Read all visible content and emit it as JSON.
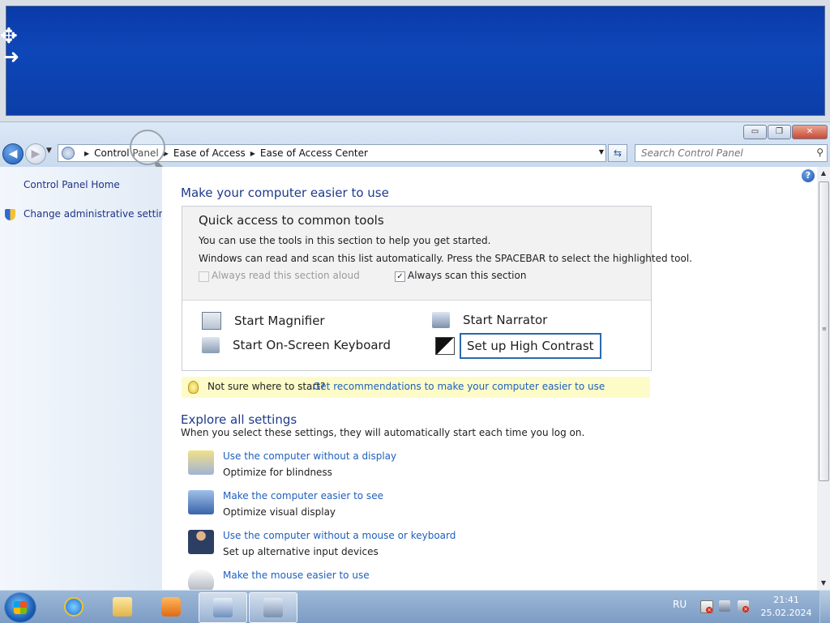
{
  "window": {
    "controls": {
      "minimize": "▭",
      "maximize": "❐",
      "close": "✕"
    }
  },
  "nav": {
    "back": "◀",
    "forward": "▶",
    "breadcrumbs": [
      "Control Panel",
      "Ease of Access",
      "Ease of Access Center"
    ],
    "search_placeholder": "Search Control Panel"
  },
  "sidebar": {
    "items": [
      {
        "label": "Control Panel Home",
        "icon": null
      },
      {
        "label": "Change administrative settings",
        "icon": "shield-icon"
      }
    ]
  },
  "main": {
    "heading": "Make your computer easier to use",
    "quick_access": {
      "title": "Quick access to common tools",
      "line1": "You can use the tools in this section to help you get started.",
      "line2": "Windows can read and scan this list automatically.  Press the SPACEBAR to select the highlighted tool.",
      "read_aloud": {
        "label": "Always read this section aloud",
        "checked": false,
        "enabled": false
      },
      "always_scan": {
        "label": "Always scan this section",
        "checked": true,
        "enabled": true
      },
      "tools": [
        {
          "label": "Start Magnifier",
          "icon": "magnifier-icon"
        },
        {
          "label": "Start Narrator",
          "icon": "narrator-icon"
        },
        {
          "label": "Start On-Screen Keyboard",
          "icon": "keyboard-icon"
        },
        {
          "label": "Set up High Contrast",
          "icon": "high-contrast-icon",
          "focused": true
        }
      ]
    },
    "tip": {
      "text": "Not sure where to start?",
      "link": "Get recommendations to make your computer easier to use"
    },
    "explore": {
      "heading": "Explore all settings",
      "intro": "When you select these settings, they will automatically start each time you log on.",
      "settings": [
        {
          "link": "Use the computer without a display",
          "desc": "Optimize for blindness",
          "icon": "display-speaker-icon"
        },
        {
          "link": "Make the computer easier to see",
          "desc": "Optimize visual display",
          "icon": "monitor-magnifier-icon"
        },
        {
          "link": "Use the computer without a mouse or keyboard",
          "desc": "Set up alternative input devices",
          "icon": "person-icon"
        },
        {
          "link": "Make the mouse easier to use",
          "desc": "",
          "icon": "mouse-icon"
        }
      ]
    }
  },
  "taskbar": {
    "language": "RU",
    "time": "21:41",
    "date": "25.02.2024",
    "apps": [
      "internet-explorer-icon",
      "folder-icon",
      "media-player-icon",
      "control-panel-icon",
      "magnifier-app-icon"
    ]
  }
}
